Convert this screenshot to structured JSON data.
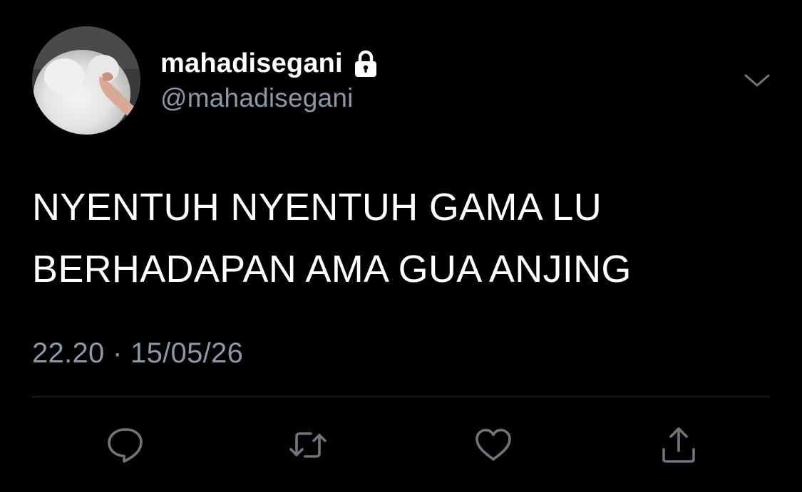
{
  "user": {
    "display_name": "mahadisegani",
    "handle": "@mahadisegani",
    "protected_icon": "lock-icon"
  },
  "tweet": {
    "lines": [
      "NYENTUH NYENTUH GAMA LU",
      "BERHADAPAN AMA GUA ANJING"
    ],
    "timestamp": "22.20 · 15/05/26"
  },
  "actions": [
    {
      "name": "reply",
      "icon": "speech-bubble-icon"
    },
    {
      "name": "retweet",
      "icon": "retweet-arrows-icon"
    },
    {
      "name": "like",
      "icon": "heart-icon"
    },
    {
      "name": "share",
      "icon": "share-icon"
    }
  ],
  "colors": {
    "background": "#000000",
    "primary_text": "#ffffff",
    "secondary_text": "#8b98a5",
    "divider": "#2f3336"
  }
}
